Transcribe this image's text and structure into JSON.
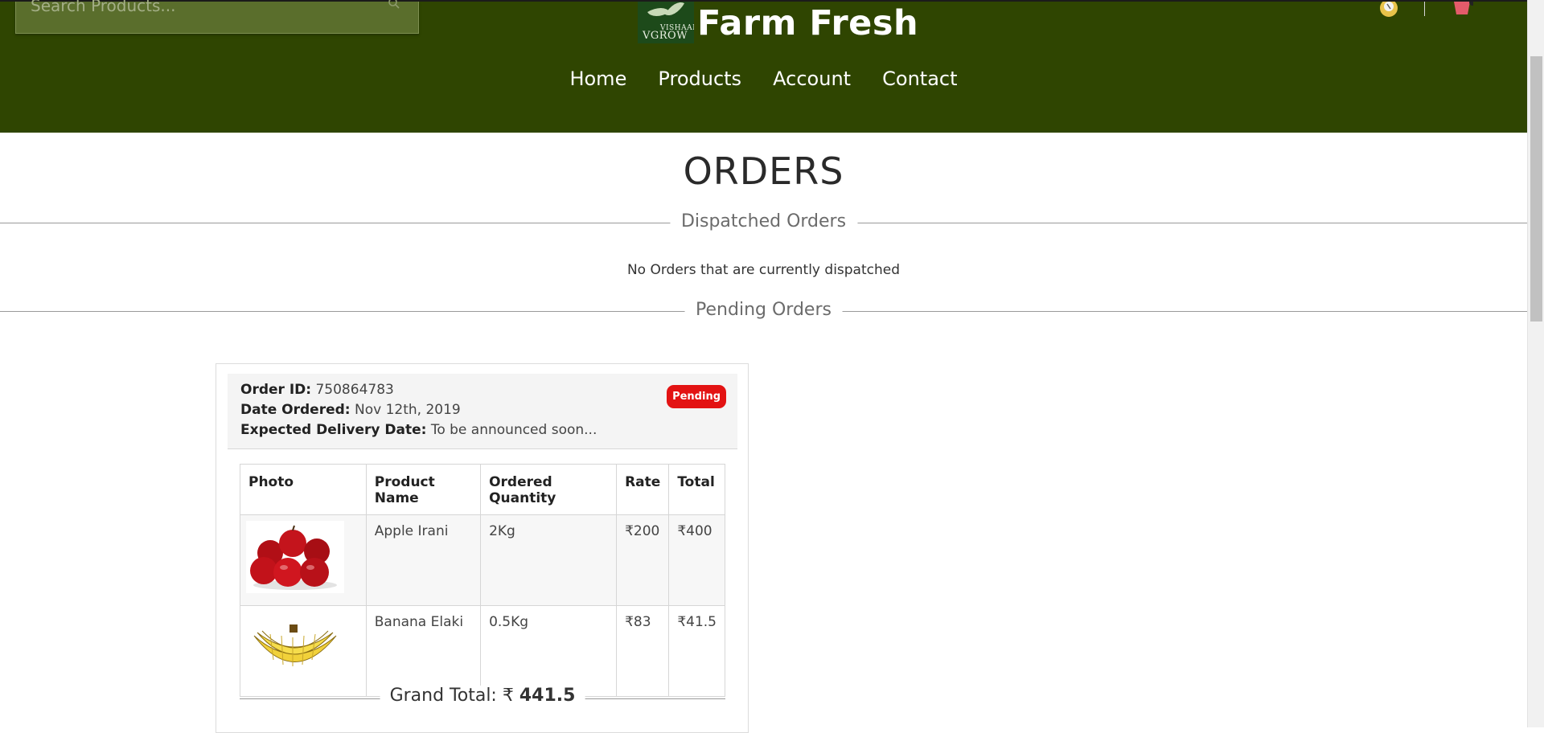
{
  "header": {
    "search_placeholder": "Search Products...",
    "brand_small_top": "VISHAAL",
    "brand_small_bottom": "VGROW",
    "brand": "Farm Fresh",
    "nav": [
      "Home",
      "Products",
      "Account",
      "Contact"
    ]
  },
  "page": {
    "title": "ORDERS",
    "dispatched_section": "Dispatched Orders",
    "no_dispatched": "No Orders that are currently dispatched",
    "pending_section": "Pending Orders"
  },
  "order": {
    "id_label": "Order ID:",
    "id": "750864783",
    "date_label": "Date Ordered:",
    "date": "Nov 12th, 2019",
    "delivery_label": "Expected Delivery Date:",
    "delivery": "To be announced soon...",
    "status": "Pending",
    "status_color": "#e31313",
    "columns": [
      "Photo",
      "Product Name",
      "Ordered Quantity",
      "Rate",
      "Total"
    ],
    "items": [
      {
        "photo": "apple-image",
        "name": "Apple Irani",
        "quantity": "2Kg",
        "rate": "₹200",
        "total": "₹400"
      },
      {
        "photo": "banana-image",
        "name": "Banana Elaki",
        "quantity": "0.5Kg",
        "rate": "₹83",
        "total": "₹41.5"
      }
    ],
    "grand_total_label": "Grand Total: ₹",
    "grand_total": "441.5"
  },
  "colors": {
    "header_bg": "#2f4501",
    "badge": "#e31313"
  }
}
